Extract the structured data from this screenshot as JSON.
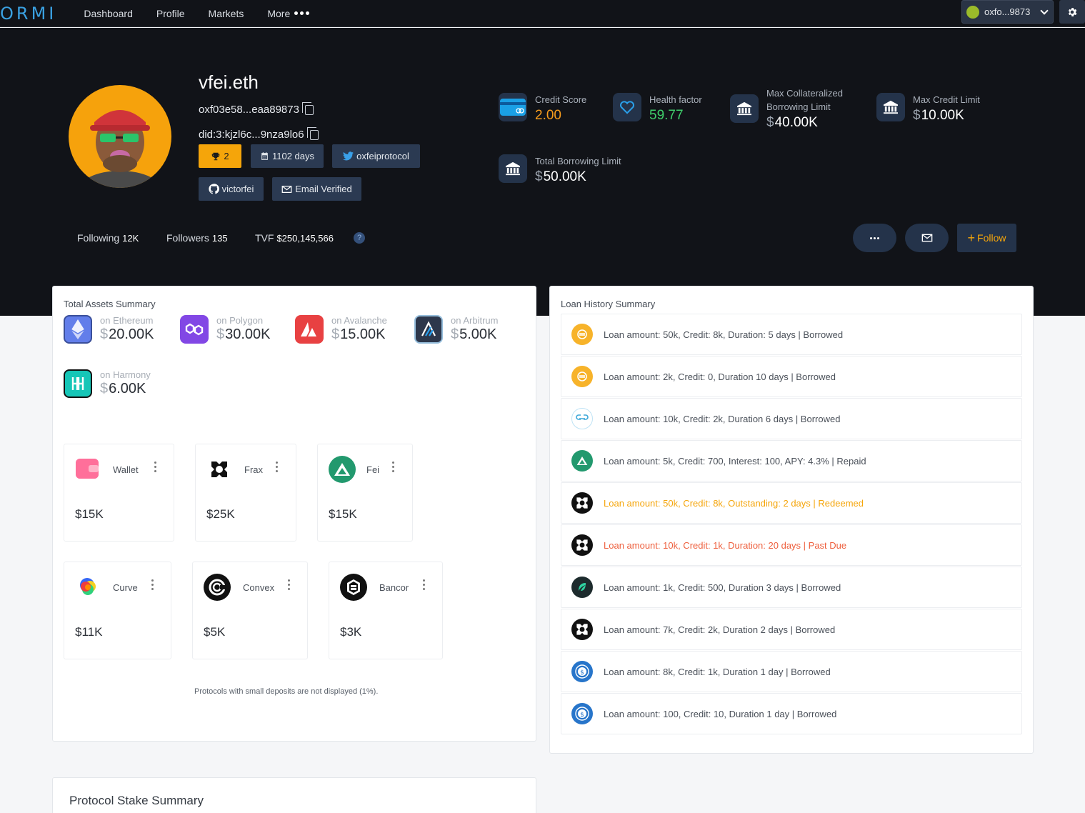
{
  "nav": {
    "logo": "ORMI",
    "items": [
      "Dashboard",
      "Profile",
      "Markets",
      "More"
    ],
    "wallet": "oxfo...9873"
  },
  "profile": {
    "username": "vfei.eth",
    "address": "oxf03e58...eaa89873",
    "did": "did:3:kjzl6c...9nza9lo6",
    "chips": {
      "trophies": "2",
      "days": "1102 days",
      "twitter": "oxfeiprotocol",
      "github": "victorfei",
      "email": "Email Verified"
    },
    "following_label": "Following",
    "following": "12K",
    "followers_label": "Followers",
    "followers": "135",
    "tvf_label": "TVF",
    "tvf": "$250,145,566",
    "follow_label": "Follow"
  },
  "stats": {
    "credit_score_label": "Credit Score",
    "credit_score": "2.00",
    "health_label": "Health factor",
    "health": "59.77",
    "max_collat_label": "Max Collateralized Borrowing Limit",
    "max_collat": "40.00K",
    "max_credit_label": "Max Credit Limit",
    "max_credit": "10.00K",
    "total_borrow_label": "Total Borrowing Limit",
    "total_borrow": "50.00K"
  },
  "assets": {
    "title": "Total Assets Summary",
    "chains": [
      {
        "label": "on Ethereum",
        "value": "20.00K"
      },
      {
        "label": "on Polygon",
        "value": "30.00K"
      },
      {
        "label": "on Avalanche",
        "value": "15.00K"
      },
      {
        "label": "on Arbitrum",
        "value": "5.00K"
      },
      {
        "label": "on Harmony",
        "value": "6.00K"
      }
    ],
    "protocols": [
      {
        "name": "Wallet",
        "value": "$15K"
      },
      {
        "name": "Frax",
        "value": "$25K"
      },
      {
        "name": "Fei",
        "value": "$15K"
      },
      {
        "name": "Curve",
        "value": "$11K"
      },
      {
        "name": "Convex",
        "value": "$5K"
      },
      {
        "name": "Bancor",
        "value": "$3K"
      }
    ],
    "note": "Protocols with small deposits are not displayed (1%)."
  },
  "loans": {
    "title": "Loan History Summary",
    "rows": [
      "Loan amount: 50k, Credit: 8k, Duration: 5 days | Borrowed",
      "Loan amount: 2k, Credit: 0, Duration 10 days | Borrowed",
      "Loan amount: 10k, Credit: 2k, Duration 6 days | Borrowed",
      "Loan amount: 5k, Credit: 700, Interest: 100, APY: 4.3% | Repaid",
      "Loan amount: 50k, Credit: 8k, Outstanding: 2 days | Redeemed",
      "Loan amount: 10k, Credit: 1k, Duration: 20 days | Past Due",
      "Loan amount: 1k, Credit: 500, Duration 3 days | Borrowed",
      "Loan amount: 7k, Credit: 2k, Duration 2 days | Borrowed",
      "Loan amount: 8k, Credit: 1k, Duration 1 day | Borrowed",
      "Loan amount: 100, Credit: 10, Duration 1 day | Borrowed"
    ]
  },
  "stake": {
    "title": "Protocol Stake Summary"
  },
  "colors": {
    "accent": "#f5a50a",
    "nav_bg": "#111318",
    "chip_bg": "#2b3a52",
    "warn": "#f5a50a",
    "danger": "#ee5f3d",
    "health": "#3fcf6b"
  }
}
